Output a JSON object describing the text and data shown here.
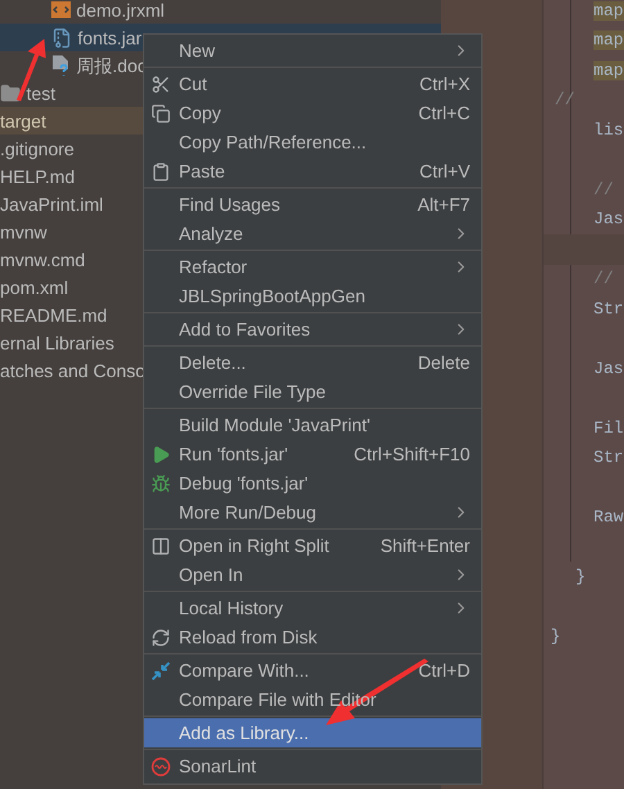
{
  "tree": {
    "items": [
      {
        "label": "demo.jrxml",
        "kind": "report",
        "selected": false
      },
      {
        "label": "fonts.jar",
        "kind": "archive",
        "selected": true
      },
      {
        "label": "周报.doc",
        "kind": "unknown",
        "selected": false
      },
      {
        "label": "test",
        "kind": "folder",
        "selected": false
      },
      {
        "label": "target",
        "kind": "excluded",
        "selected": false
      },
      {
        "label": ".gitignore",
        "kind": "plain",
        "selected": false
      },
      {
        "label": "HELP.md",
        "kind": "plain",
        "selected": false
      },
      {
        "label": "JavaPrint.iml",
        "kind": "plain",
        "selected": false
      },
      {
        "label": "mvnw",
        "kind": "plain",
        "selected": false
      },
      {
        "label": "mvnw.cmd",
        "kind": "plain",
        "selected": false
      },
      {
        "label": "pom.xml",
        "kind": "plain",
        "selected": false
      },
      {
        "label": "README.md",
        "kind": "plain",
        "selected": false
      },
      {
        "label": "ernal Libraries",
        "kind": "plain",
        "selected": false
      },
      {
        "label": "atches and Conso",
        "kind": "plain",
        "selected": false
      }
    ]
  },
  "editor": {
    "lines": [
      {
        "text": "map",
        "kind": "highlighted"
      },
      {
        "text": "map",
        "kind": "highlighted"
      },
      {
        "text": "map",
        "kind": "highlighted"
      },
      {
        "text": "//",
        "kind": "gutter-comment"
      },
      {
        "text": "lis",
        "kind": "code"
      },
      {
        "kind": "blank"
      },
      {
        "text": "//",
        "kind": "comment"
      },
      {
        "text": "Jas",
        "kind": "code"
      },
      {
        "kind": "current"
      },
      {
        "text": "//",
        "kind": "comment"
      },
      {
        "text": "Str",
        "kind": "code"
      },
      {
        "kind": "blank"
      },
      {
        "text": "Jas",
        "kind": "code"
      },
      {
        "kind": "blank"
      },
      {
        "text": "Fil",
        "kind": "code"
      },
      {
        "text": "Str",
        "kind": "code"
      },
      {
        "kind": "blank"
      },
      {
        "text": "Raw",
        "kind": "code"
      },
      {
        "kind": "blank"
      },
      {
        "text": "}",
        "kind": "inner-brace"
      },
      {
        "kind": "blank"
      },
      {
        "text": "}",
        "kind": "outer-brace"
      }
    ]
  },
  "context_menu": {
    "groups": [
      [
        {
          "label": "New",
          "kind": "plain",
          "submenu": true,
          "selected": false
        }
      ],
      [
        {
          "label": "Cut",
          "shortcut": "Ctrl+X",
          "kind": "cut",
          "submenu": false,
          "selected": false
        },
        {
          "label": "Copy",
          "shortcut": "Ctrl+C",
          "kind": "copy",
          "submenu": false,
          "selected": false
        },
        {
          "label": "Copy Path/Reference...",
          "kind": "plain",
          "submenu": false,
          "selected": false
        },
        {
          "label": "Paste",
          "shortcut": "Ctrl+V",
          "kind": "paste",
          "submenu": false,
          "selected": false
        }
      ],
      [
        {
          "label": "Find Usages",
          "shortcut": "Alt+F7",
          "kind": "plain",
          "submenu": false,
          "selected": false
        },
        {
          "label": "Analyze",
          "kind": "plain",
          "submenu": true,
          "selected": false
        }
      ],
      [
        {
          "label": "Refactor",
          "kind": "plain",
          "submenu": true,
          "selected": false
        },
        {
          "label": "JBLSpringBootAppGen",
          "kind": "plain",
          "submenu": false,
          "selected": false
        }
      ],
      [
        {
          "label": "Add to Favorites",
          "kind": "plain",
          "submenu": true,
          "selected": false
        }
      ],
      [
        {
          "label": "Delete...",
          "shortcut": "Delete",
          "kind": "plain",
          "submenu": false,
          "selected": false
        },
        {
          "label": "Override File Type",
          "kind": "plain",
          "submenu": false,
          "selected": false
        }
      ],
      [
        {
          "label": "Build Module 'JavaPrint'",
          "kind": "plain",
          "submenu": false,
          "selected": false
        },
        {
          "label": "Run 'fonts.jar'",
          "shortcut": "Ctrl+Shift+F10",
          "kind": "run",
          "submenu": false,
          "selected": false
        },
        {
          "label": "Debug 'fonts.jar'",
          "kind": "debug",
          "submenu": false,
          "selected": false
        },
        {
          "label": "More Run/Debug",
          "kind": "plain",
          "submenu": true,
          "selected": false
        }
      ],
      [
        {
          "label": "Open in Right Split",
          "shortcut": "Shift+Enter",
          "kind": "split",
          "submenu": false,
          "selected": false
        },
        {
          "label": "Open In",
          "kind": "plain",
          "submenu": true,
          "selected": false
        }
      ],
      [
        {
          "label": "Local History",
          "kind": "plain",
          "submenu": true,
          "selected": false
        },
        {
          "label": "Reload from Disk",
          "kind": "reload",
          "submenu": false,
          "selected": false
        }
      ],
      [
        {
          "label": "Compare With...",
          "shortcut": "Ctrl+D",
          "kind": "compare",
          "submenu": false,
          "selected": false
        },
        {
          "label": "Compare File with Editor",
          "kind": "plain",
          "submenu": false,
          "selected": false
        }
      ],
      [
        {
          "label": "Add as Library...",
          "kind": "plain",
          "submenu": false,
          "selected": true
        }
      ],
      [
        {
          "label": "SonarLint",
          "kind": "sonarlint",
          "submenu": false,
          "selected": false
        }
      ]
    ]
  }
}
